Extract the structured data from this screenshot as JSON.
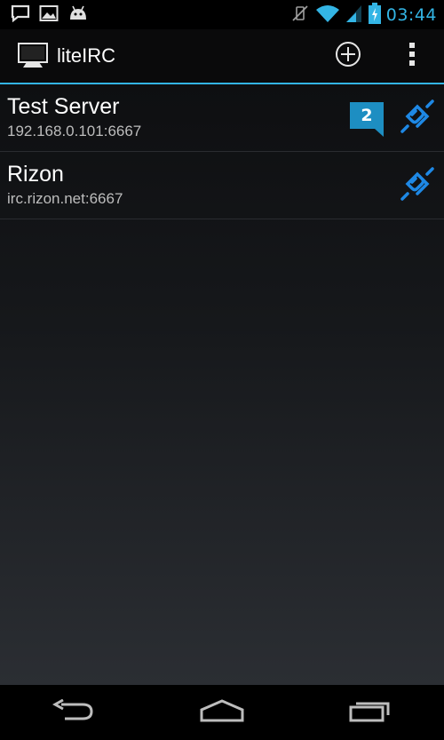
{
  "status_bar": {
    "time": "03:44",
    "left_icons": [
      "chat-notification-icon",
      "image-notification-icon",
      "android-notification-icon"
    ],
    "right_icons": [
      "vibrate-off-icon",
      "wifi-icon",
      "cell-signal-icon",
      "battery-charging-icon"
    ]
  },
  "action_bar": {
    "title": "liteIRC",
    "actions": [
      "add-icon",
      "overflow-menu-icon"
    ]
  },
  "servers": [
    {
      "name": "Test Server",
      "host": "192.168.0.101:6667",
      "unread": "2",
      "status_icon": "plug-icon"
    },
    {
      "name": "Rizon",
      "host": "irc.rizon.net:6667",
      "unread": "",
      "status_icon": "plug-icon"
    }
  ],
  "nav_bar": {
    "buttons": [
      "back-icon",
      "home-icon",
      "recent-apps-icon"
    ]
  },
  "colors": {
    "accent": "#33b5e5",
    "badge": "#1d8ec2",
    "plug": "#1e88e5",
    "text_primary": "#ffffff",
    "text_secondary": "#bdbdbd"
  }
}
